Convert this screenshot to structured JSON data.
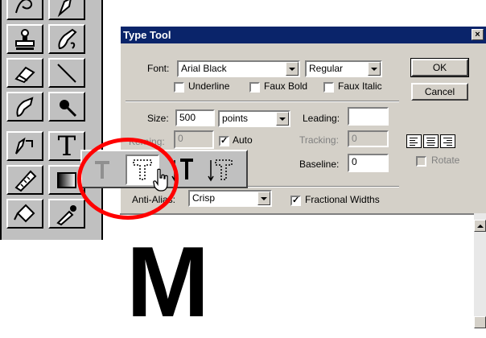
{
  "dialog": {
    "title": "Type Tool",
    "close_label": "×",
    "font_label": "Font:",
    "font_value": "Arial Black",
    "style_value": "Regular",
    "ok_label": "OK",
    "cancel_label": "Cancel",
    "underline_label": "Underline",
    "faux_bold_label": "Faux Bold",
    "faux_italic_label": "Faux Italic",
    "size_label": "Size:",
    "size_value": "500",
    "size_unit": "points",
    "leading_label": "Leading:",
    "leading_value": "",
    "kerning_label": "Kerning:",
    "kerning_value": "0",
    "auto_label": "Auto",
    "tracking_label": "Tracking:",
    "tracking_value": "0",
    "baseline_label": "Baseline:",
    "baseline_value": "0",
    "rotate_label": "Rotate",
    "anti_alias_label": "Anti-Alias:",
    "anti_alias_value": "Crisp",
    "fractional_widths_label": "Fractional Widths",
    "checks": {
      "underline": false,
      "faux_bold": false,
      "faux_italic": false,
      "auto": true,
      "rotate": false,
      "fractional_widths": true
    }
  },
  "preview": {
    "text": "M"
  },
  "toolbox": {
    "type_tool_glyph": "T"
  },
  "flyout": {
    "items": [
      "type-tool",
      "type-mask-tool",
      "vertical-type-tool",
      "vertical-type-mask-tool"
    ],
    "selected": "type-mask-tool"
  },
  "colors": {
    "titlebar": "#0a246a",
    "dialog_bg": "#d4d0c8",
    "highlight_circle": "#ff0000"
  }
}
